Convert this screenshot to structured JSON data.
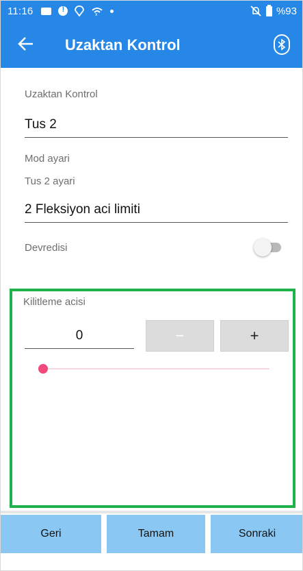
{
  "status_bar": {
    "time": "11:16",
    "battery": "%93",
    "icons": [
      "message-icon",
      "alert-icon",
      "wifi-icon",
      "signal-icon",
      "dot-icon",
      "mute-icon",
      "battery-icon"
    ],
    "bg_color": "#2787e6"
  },
  "app_bar": {
    "title": "Uzaktan Kontrol",
    "back_icon": "arrow-back-icon",
    "action_icon": "bluetooth-icon",
    "bg_color": "#2787e6"
  },
  "form": {
    "section_label": "Uzaktan Kontrol",
    "key_value": "Tus 2",
    "mode_label": "Mod ayari",
    "key_setting_label": "Tus 2 ayari",
    "mode_value": "2 Fleksiyon aci limiti",
    "disable_label": "Devredisi",
    "disable_on": false
  },
  "lock_angle": {
    "label": "Kilitleme acisi",
    "value": "0",
    "minus_label": "−",
    "plus_label": "+",
    "slider_fraction": 0,
    "highlight_color": "#1fb24a",
    "slider_color": "#f2497c"
  },
  "bottom_buttons": {
    "back": "Geri",
    "ok": "Tamam",
    "next": "Sonraki",
    "color": "#8ac8f3"
  }
}
